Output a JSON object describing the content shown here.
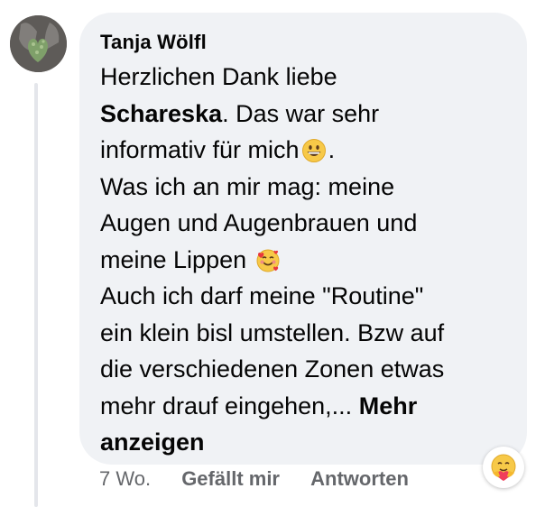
{
  "comment": {
    "author": "Tanja Wölfl",
    "text": {
      "l1": "Herzlichen Dank liebe",
      "l2_bold": "Schareska",
      "l2_rest": ". Das war sehr",
      "l3_a": "informativ für mich",
      "l3_b": ".",
      "l4": "Was ich an mir mag: meine",
      "l5": "Augen und Augenbrauen und",
      "l6": "meine Lippen",
      "l7": "Auch ich darf meine \"Routine\"",
      "l8": "ein klein bisl umstellen. Bzw auf",
      "l9": "die verschiedenen Zonen etwas",
      "l10": "mehr drauf eingehen,...",
      "see_more_a": "Mehr",
      "see_more_b": "anzeigen"
    },
    "emojis": {
      "inline_1": "grinning-face-icon",
      "inline_2": "smiling-face-with-hearts-icon"
    },
    "reaction_icon": "care-reaction-icon"
  },
  "footer": {
    "time": "7 Wo.",
    "like": "Gefällt mir",
    "reply": "Antworten"
  },
  "colors": {
    "bubble": "#f0f2f5",
    "text": "#050505",
    "meta": "#65676b",
    "thread_line": "#e4e6eb"
  }
}
